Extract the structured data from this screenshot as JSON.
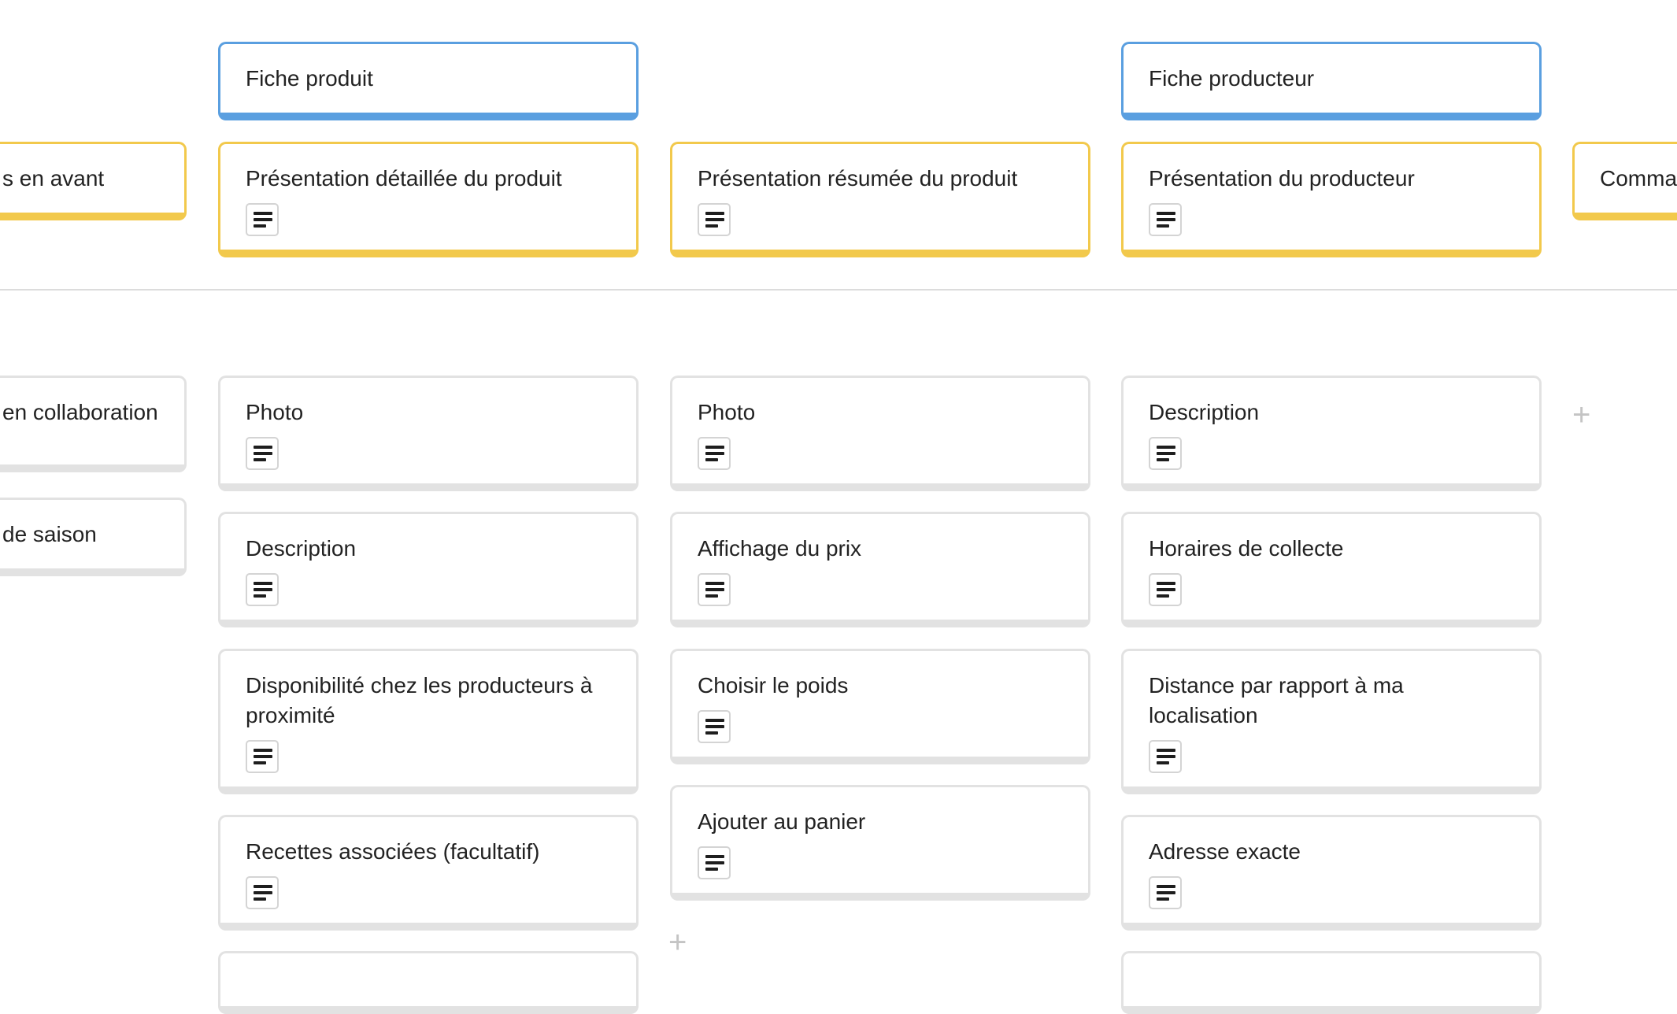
{
  "activities": {
    "fiche_produit": "Fiche produit",
    "fiche_producteur": "Fiche producteur"
  },
  "steps": {
    "mise_en_avant": "s en avant",
    "presentation_detaillee": "Présentation détaillée du produit",
    "presentation_resumee": "Présentation résumée du produit",
    "presentation_producteur": "Présentation du producteur",
    "commande": "Comma"
  },
  "stories": {
    "col0": [
      "en collaboration",
      "de saison"
    ],
    "col1": [
      "Photo",
      "Description",
      "Disponibilité chez les producteurs à proximité",
      "Recettes associées (facultatif)"
    ],
    "col2": [
      "Photo",
      "Affichage du prix",
      "Choisir le poids",
      "Ajouter au panier"
    ],
    "col3": [
      "Description",
      "Horaires de collecte",
      "Distance par rapport à ma localisation",
      "Adresse exacte"
    ]
  },
  "add_symbol": "+",
  "icons": {
    "description": "description-icon",
    "add": "plus-icon"
  },
  "colors": {
    "activity_border": "#5a9fe0",
    "step_border": "#f2c94c",
    "story_border": "#e2e2e2"
  }
}
